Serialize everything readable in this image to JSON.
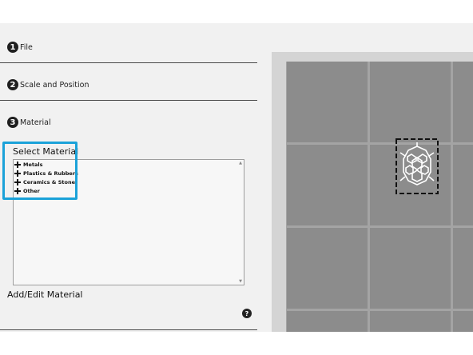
{
  "steps": [
    {
      "number": "1",
      "label": "File"
    },
    {
      "number": "2",
      "label": "Scale and Position"
    },
    {
      "number": "3",
      "label": "Material"
    }
  ],
  "material": {
    "select_title": "Select Material",
    "items": [
      "Metals",
      "Plastics & Rubbers",
      "Ceramics & Stone",
      "Other"
    ],
    "add_edit_label": "Add/Edit Material",
    "help_glyph": "?"
  },
  "viewport": {
    "model_icon": "tortoise-shell-icon"
  },
  "colors": {
    "highlight": "#1ba2d9",
    "panel_bg": "#f1f1f1",
    "grid_tile": "#8c8c8c"
  }
}
